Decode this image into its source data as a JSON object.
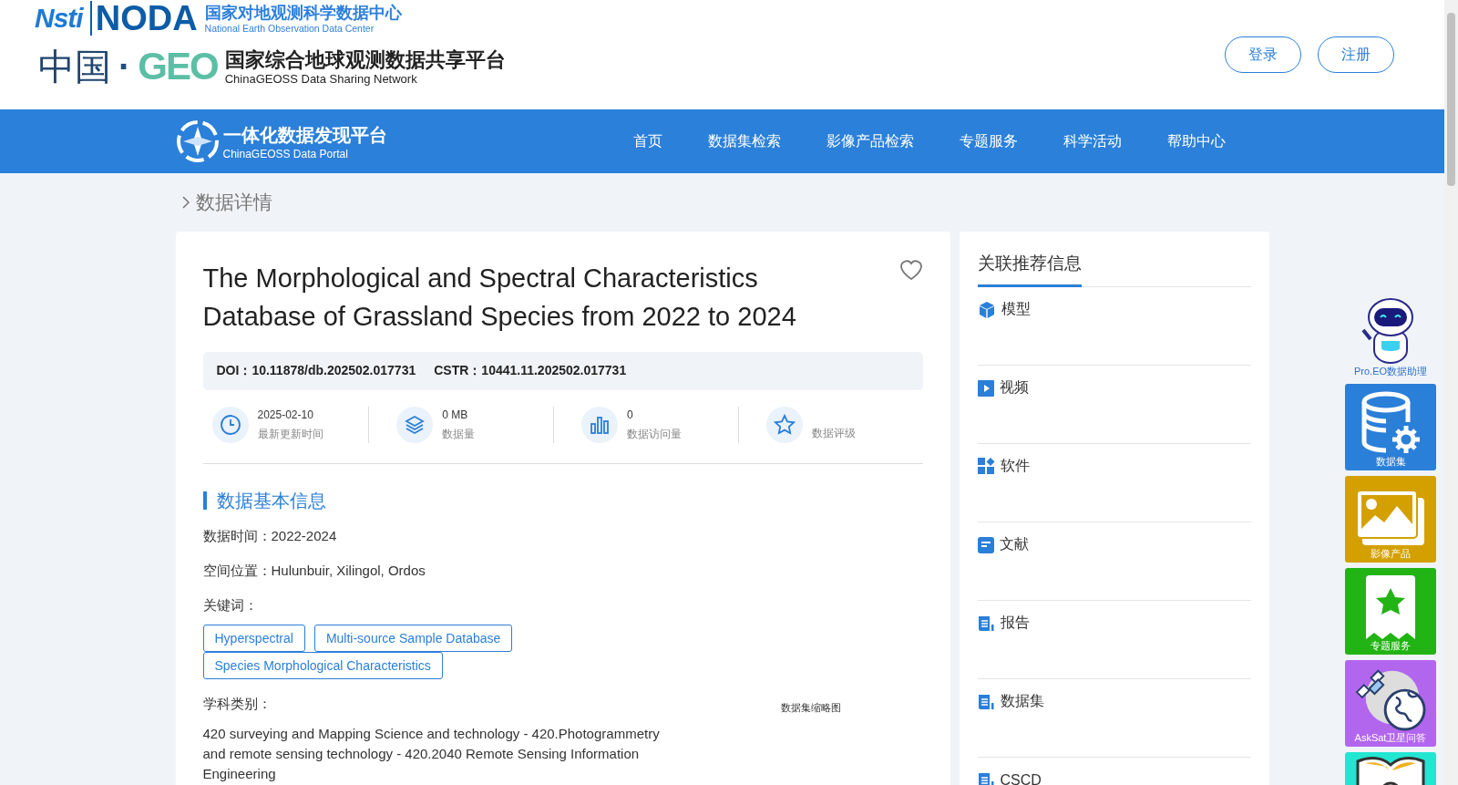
{
  "header": {
    "logo_top": {
      "mark_left": "Nsti",
      "mark_right": "NODA",
      "title_cn": "国家对地观测科学数据中心",
      "title_en": "National Earth Observation Data Center"
    },
    "logo_bottom": {
      "mark_cn": "中国",
      "mark_sep": "·",
      "mark_geo": "GEO",
      "title_cn": "国家综合地球观测数据共享平台",
      "title_en": "ChinaGEOSS Data Sharing Network"
    },
    "buttons": [
      "登录",
      "注册"
    ]
  },
  "nav": {
    "logo_cn": "一体化数据发现平台",
    "logo_en": "ChinaGEOSS Data Portal",
    "items": [
      "首页",
      "数据集检索",
      "影像产品检索",
      "专题服务",
      "科学活动",
      "帮助中心"
    ]
  },
  "breadcrumb": "数据详情",
  "dataset": {
    "title": "The Morphological and Spectral Characteristics Database of Grassland Species from 2022 to 2024",
    "favorited": false,
    "ids": [
      {
        "label": "DOI：",
        "value": "10.11878/db.202502.017731"
      },
      {
        "label": "CSTR：",
        "value": "10441.11.202502.017731"
      }
    ],
    "stats": [
      {
        "kind": "clock",
        "value": "2025-02-10",
        "label": "最新更新时间"
      },
      {
        "kind": "layers",
        "value": "0 MB",
        "label": "数据量"
      },
      {
        "kind": "bars",
        "value": "0",
        "label": "数据访问量"
      },
      {
        "kind": "star",
        "label": "数据评级"
      }
    ],
    "section_title": "数据基本信息",
    "fields": [
      {
        "label": "数据时间：",
        "value": "2022-2024"
      },
      {
        "label": "空间位置：",
        "value": "Hulunbuir, Xilingol, Ordos"
      }
    ],
    "keywords_label": "关键词：",
    "keywords": [
      "Hyperspectral",
      "Multi-source Sample Database",
      "Species Morphological Characteristics"
    ],
    "subject_label": "学科类别：",
    "subject": "420 surveying and Mapping Science and technology - 420.Photogrammetry and remote sensing technology - 420.2040 Remote Sensing Information Engineering",
    "thumbnail_label": "数据集缩略图"
  },
  "related": {
    "title": "关联推荐信息",
    "items": [
      {
        "kind": "cube",
        "label": "模型"
      },
      {
        "kind": "play",
        "label": "视频"
      },
      {
        "kind": "apps",
        "label": "软件"
      },
      {
        "kind": "doc",
        "label": "文献"
      },
      {
        "kind": "report",
        "label": "报告"
      },
      {
        "kind": "report",
        "label": "数据集"
      },
      {
        "kind": "report",
        "label": "CSCD"
      }
    ]
  },
  "float_panel": {
    "assistant": "Pro.EO数据助理",
    "tiles": [
      {
        "kind": "database",
        "label": "数据集",
        "color": "#2a7fd8"
      },
      {
        "kind": "image",
        "label": "影像产品",
        "color": "#d4a000"
      },
      {
        "kind": "ribbon",
        "label": "专题服务",
        "color": "#22b414"
      },
      {
        "kind": "satellite",
        "label": "AskSat卫星问答",
        "color": "#b266ee"
      },
      {
        "kind": "book",
        "color": "#22e6d2"
      }
    ]
  }
}
